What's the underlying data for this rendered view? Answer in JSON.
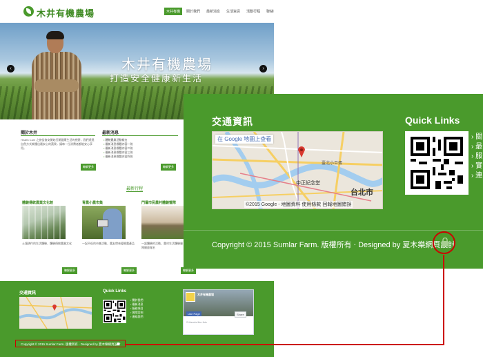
{
  "site": {
    "logo_text": "木井有機農場",
    "nav": [
      "木井有機",
      "關於我們",
      "最新消息",
      "生活資訊",
      "活動行程",
      "聯絡我們"
    ],
    "hero": {
      "title": "木井有機農場",
      "subtitle": "打造安全健康新生活",
      "prev_icon": "‹",
      "next_icon": "›"
    },
    "about": {
      "title": "關於木井",
      "text": "Health Care 之旅從食安開始打開健康生活的視野，我們透過自然方式栽種出最安心的蔬果，讓每一位消費者都能安心享用。",
      "button": "瞭解更多"
    },
    "news": {
      "title": "最新消息",
      "items": [
        "體驗農業活動報名",
        "最新消息標題內容一則",
        "最新消息標題內容二則",
        "最新消息標題內容三則",
        "最新消息標題內容四則"
      ],
      "button": "瞭解更多"
    },
    "activities": {
      "more": "最新行程",
      "items": [
        {
          "title": "體驗傳統農業文化館",
          "text": "土壤耕作的生活體驗，體驗傳統農業文化",
          "button": "瞭解更多"
        },
        {
          "title": "青農小農市集",
          "text": "一起不低的市集活動，農友帶來優質農產品",
          "button": "瞭解更多"
        },
        {
          "title": "門壇市民農村體驗營隊",
          "text": "一起體驗的活動，農村生活體驗營隊開放報名",
          "button": "瞭解更多"
        }
      ]
    },
    "footer": {
      "traffic_title": "交通資訊",
      "links_title": "Quick Links",
      "links": [
        "關於我們",
        "最新消息",
        "服務項目",
        "實際案例",
        "連絡我們"
      ],
      "fb_page_name": "木井有機農場",
      "fb_like": "Like Page",
      "fb_share": "Share",
      "fb_friends": "2 friends like this",
      "copyright": "Copyright © 2015 Sumlar Farm. 版權所有 ‧ Designed by 夏木樂網頁設計"
    }
  },
  "zoom": {
    "traffic_title": "交通資訊",
    "links_title": "Quick Links",
    "links": [
      "關",
      "最",
      "服",
      "實",
      "連"
    ],
    "map": {
      "view_link": "在 Google 地圖上查看",
      "city": "台北市",
      "landmark1": "中正紀念堂",
      "landmark2": "臺北小巨蛋",
      "footer": "©2015 Google - 地圖資料  使用條款  回報地圖錯誤"
    },
    "copyright": "Copyright © 2015 Sumlar Farm. 版權所有 ‧ Designed by 夏木樂網頁設計"
  },
  "colors": {
    "brand_green": "#4a9a2c",
    "highlight_red": "#cc0000"
  }
}
